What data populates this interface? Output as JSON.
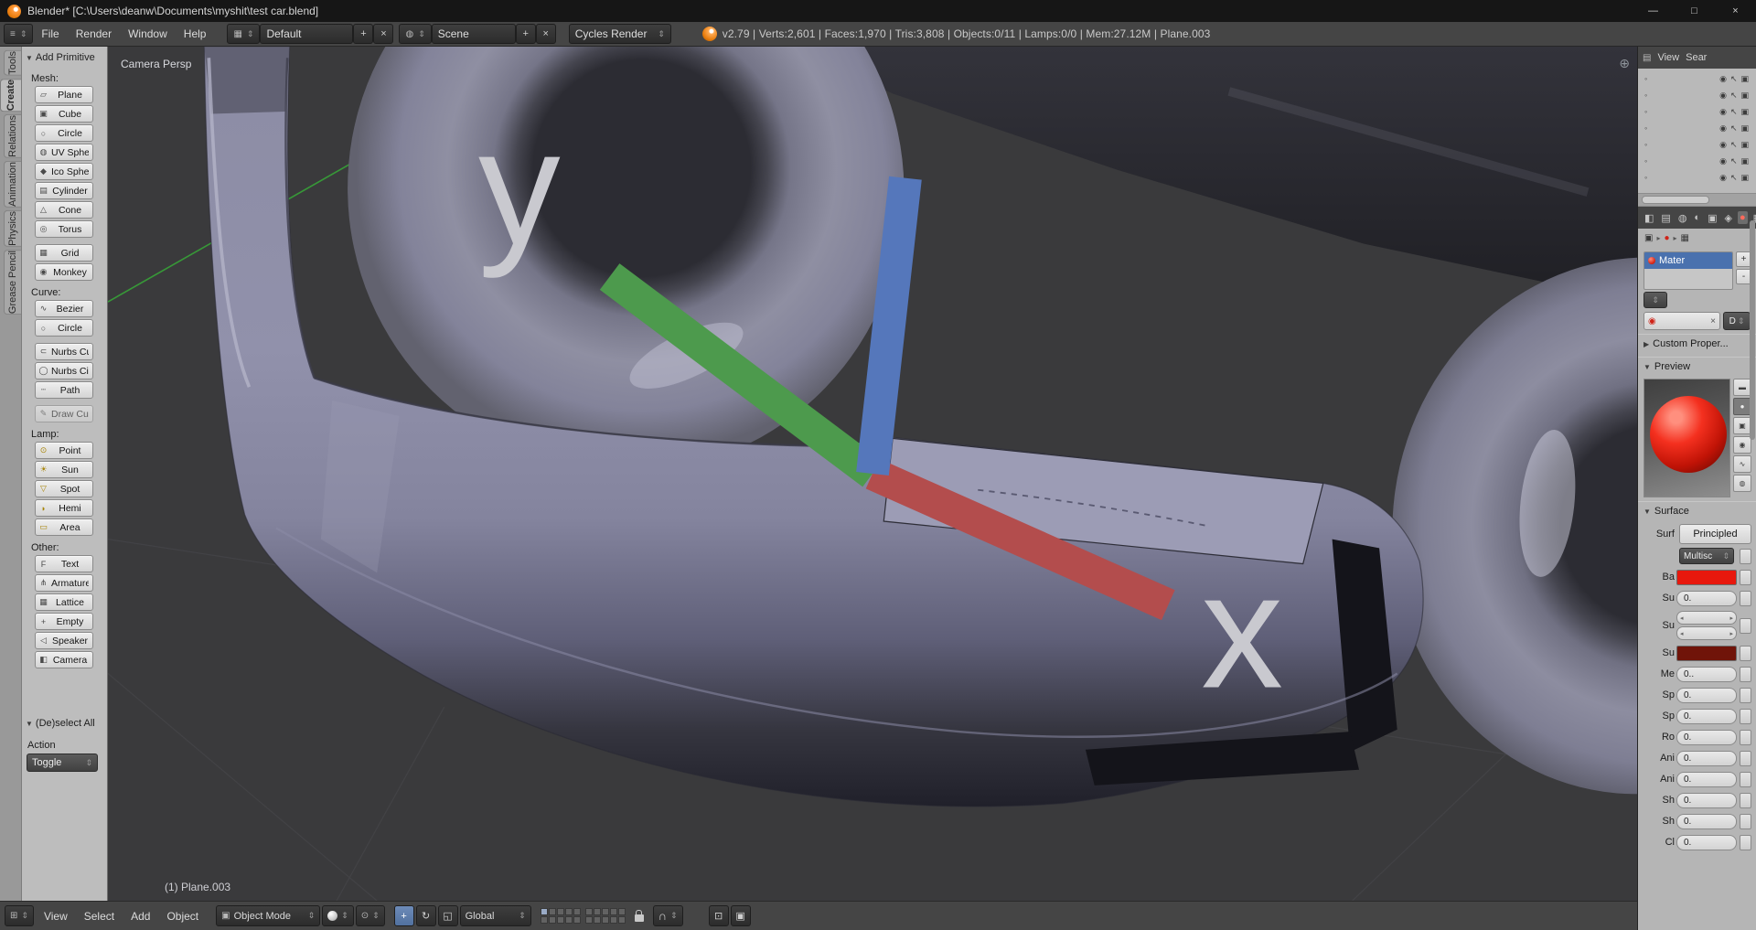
{
  "titlebar": {
    "title": "Blender* [C:\\Users\\deanw\\Documents\\myshit\\test car.blend]",
    "minimize": "—",
    "maximize": "□",
    "close": "×"
  },
  "infobar": {
    "menus": [
      "File",
      "Render",
      "Window",
      "Help"
    ],
    "layout": {
      "value": "Default",
      "add": "+",
      "remove": "×"
    },
    "scene": {
      "value": "Scene",
      "add": "+",
      "remove": "×"
    },
    "engine": {
      "value": "Cycles Render"
    },
    "stats": "v2.79 | Verts:2,601 | Faces:1,970 | Tris:3,808 | Objects:0/11 | Lamps:0/0 | Mem:27.12M | Plane.003"
  },
  "shelf_tabs": [
    {
      "label": "Tools",
      "active": false
    },
    {
      "label": "Create",
      "active": true
    },
    {
      "label": "Relations",
      "active": false
    },
    {
      "label": "Animation",
      "active": false
    },
    {
      "label": "Physics",
      "active": false
    },
    {
      "label": "Grease Pencil",
      "active": false
    }
  ],
  "tool_shelf": {
    "panel_title": "Add Primitive",
    "sections": [
      {
        "label": "Mesh:",
        "groups": [
          [
            {
              "label": "Plane",
              "icon": "plane"
            },
            {
              "label": "Cube",
              "icon": "cube"
            },
            {
              "label": "Circle",
              "icon": "circle"
            },
            {
              "label": "UV Sphere",
              "icon": "uv-sphere"
            },
            {
              "label": "Ico Sphere",
              "icon": "ico-sphere"
            },
            {
              "label": "Cylinder",
              "icon": "cylinder"
            },
            {
              "label": "Cone",
              "icon": "cone"
            },
            {
              "label": "Torus",
              "icon": "torus"
            }
          ],
          [
            {
              "label": "Grid",
              "icon": "grid"
            },
            {
              "label": "Monkey",
              "icon": "monkey"
            }
          ]
        ]
      },
      {
        "label": "Curve:",
        "groups": [
          [
            {
              "label": "Bezier",
              "icon": "curve-bezier"
            },
            {
              "label": "Circle",
              "icon": "curve-circle"
            }
          ],
          [
            {
              "label": "Nurbs Cu...",
              "icon": "nurbs-curve"
            },
            {
              "label": "Nurbs Cir...",
              "icon": "nurbs-circle"
            },
            {
              "label": "Path",
              "icon": "curve-path"
            }
          ],
          [
            {
              "label": "Draw Cu...",
              "icon": "draw-curve",
              "disabled": true
            }
          ]
        ]
      },
      {
        "label": "Lamp:",
        "groups": [
          [
            {
              "label": "Point",
              "icon": "lamp-point"
            },
            {
              "label": "Sun",
              "icon": "lamp-sun"
            },
            {
              "label": "Spot",
              "icon": "lamp-spot"
            },
            {
              "label": "Hemi",
              "icon": "lamp-hemi"
            },
            {
              "label": "Area",
              "icon": "lamp-area"
            }
          ]
        ]
      },
      {
        "label": "Other:",
        "groups": [
          [
            {
              "label": "Text",
              "icon": "text"
            },
            {
              "label": "Armature",
              "icon": "armature"
            },
            {
              "label": "Lattice",
              "icon": "lattice"
            },
            {
              "label": "Empty",
              "icon": "empty"
            },
            {
              "label": "Speaker",
              "icon": "speaker"
            },
            {
              "label": "Camera",
              "icon": "camera"
            }
          ]
        ]
      }
    ],
    "deselect_panel": {
      "title": "(De)select All",
      "action_label": "Action",
      "action_value": "Toggle"
    }
  },
  "viewport": {
    "view_label": "Camera Persp",
    "object_label": "(1) Plane.003",
    "axis_x": "x",
    "axis_y": "y"
  },
  "viewport_header": {
    "menus": [
      "View",
      "Select",
      "Add",
      "Object"
    ],
    "mode": "Object Mode",
    "orientation": "Global",
    "layer_count": 20
  },
  "outliner": {
    "view_menu": "View",
    "search_menu": "Sear",
    "row_count": 7
  },
  "properties": {
    "slot_name": "Mater",
    "link_label": "D",
    "panels": {
      "custom_properties": "Custom Proper...",
      "preview": "Preview",
      "surface": "Surface"
    },
    "surface": {
      "label": "Surf",
      "shader": "Principled",
      "method": "Multisc",
      "fields": [
        {
          "label": "Ba",
          "type": "color",
          "color": "#e8180d"
        },
        {
          "label": "Su",
          "type": "number",
          "value": "0."
        },
        {
          "label": "Su",
          "type": "vector"
        },
        {
          "label": "Su",
          "type": "color",
          "color": "#701409"
        },
        {
          "label": "Me",
          "type": "number",
          "value": "0.."
        },
        {
          "label": "Sp",
          "type": "number",
          "value": "0."
        },
        {
          "label": "Sp",
          "type": "number",
          "value": "0."
        },
        {
          "label": "Ro",
          "type": "number",
          "value": "0."
        },
        {
          "label": "Ani",
          "type": "number",
          "value": "0."
        },
        {
          "label": "Ani",
          "type": "number",
          "value": "0."
        },
        {
          "label": "Sh",
          "type": "number",
          "value": "0."
        },
        {
          "label": "Sh",
          "type": "number",
          "value": "0."
        },
        {
          "label": "Cl",
          "type": "number",
          "value": "0."
        }
      ]
    }
  },
  "colors": {
    "selection_blue": "#4a71ae",
    "material_red": "#e8180d",
    "axis_green": "#37a337"
  }
}
